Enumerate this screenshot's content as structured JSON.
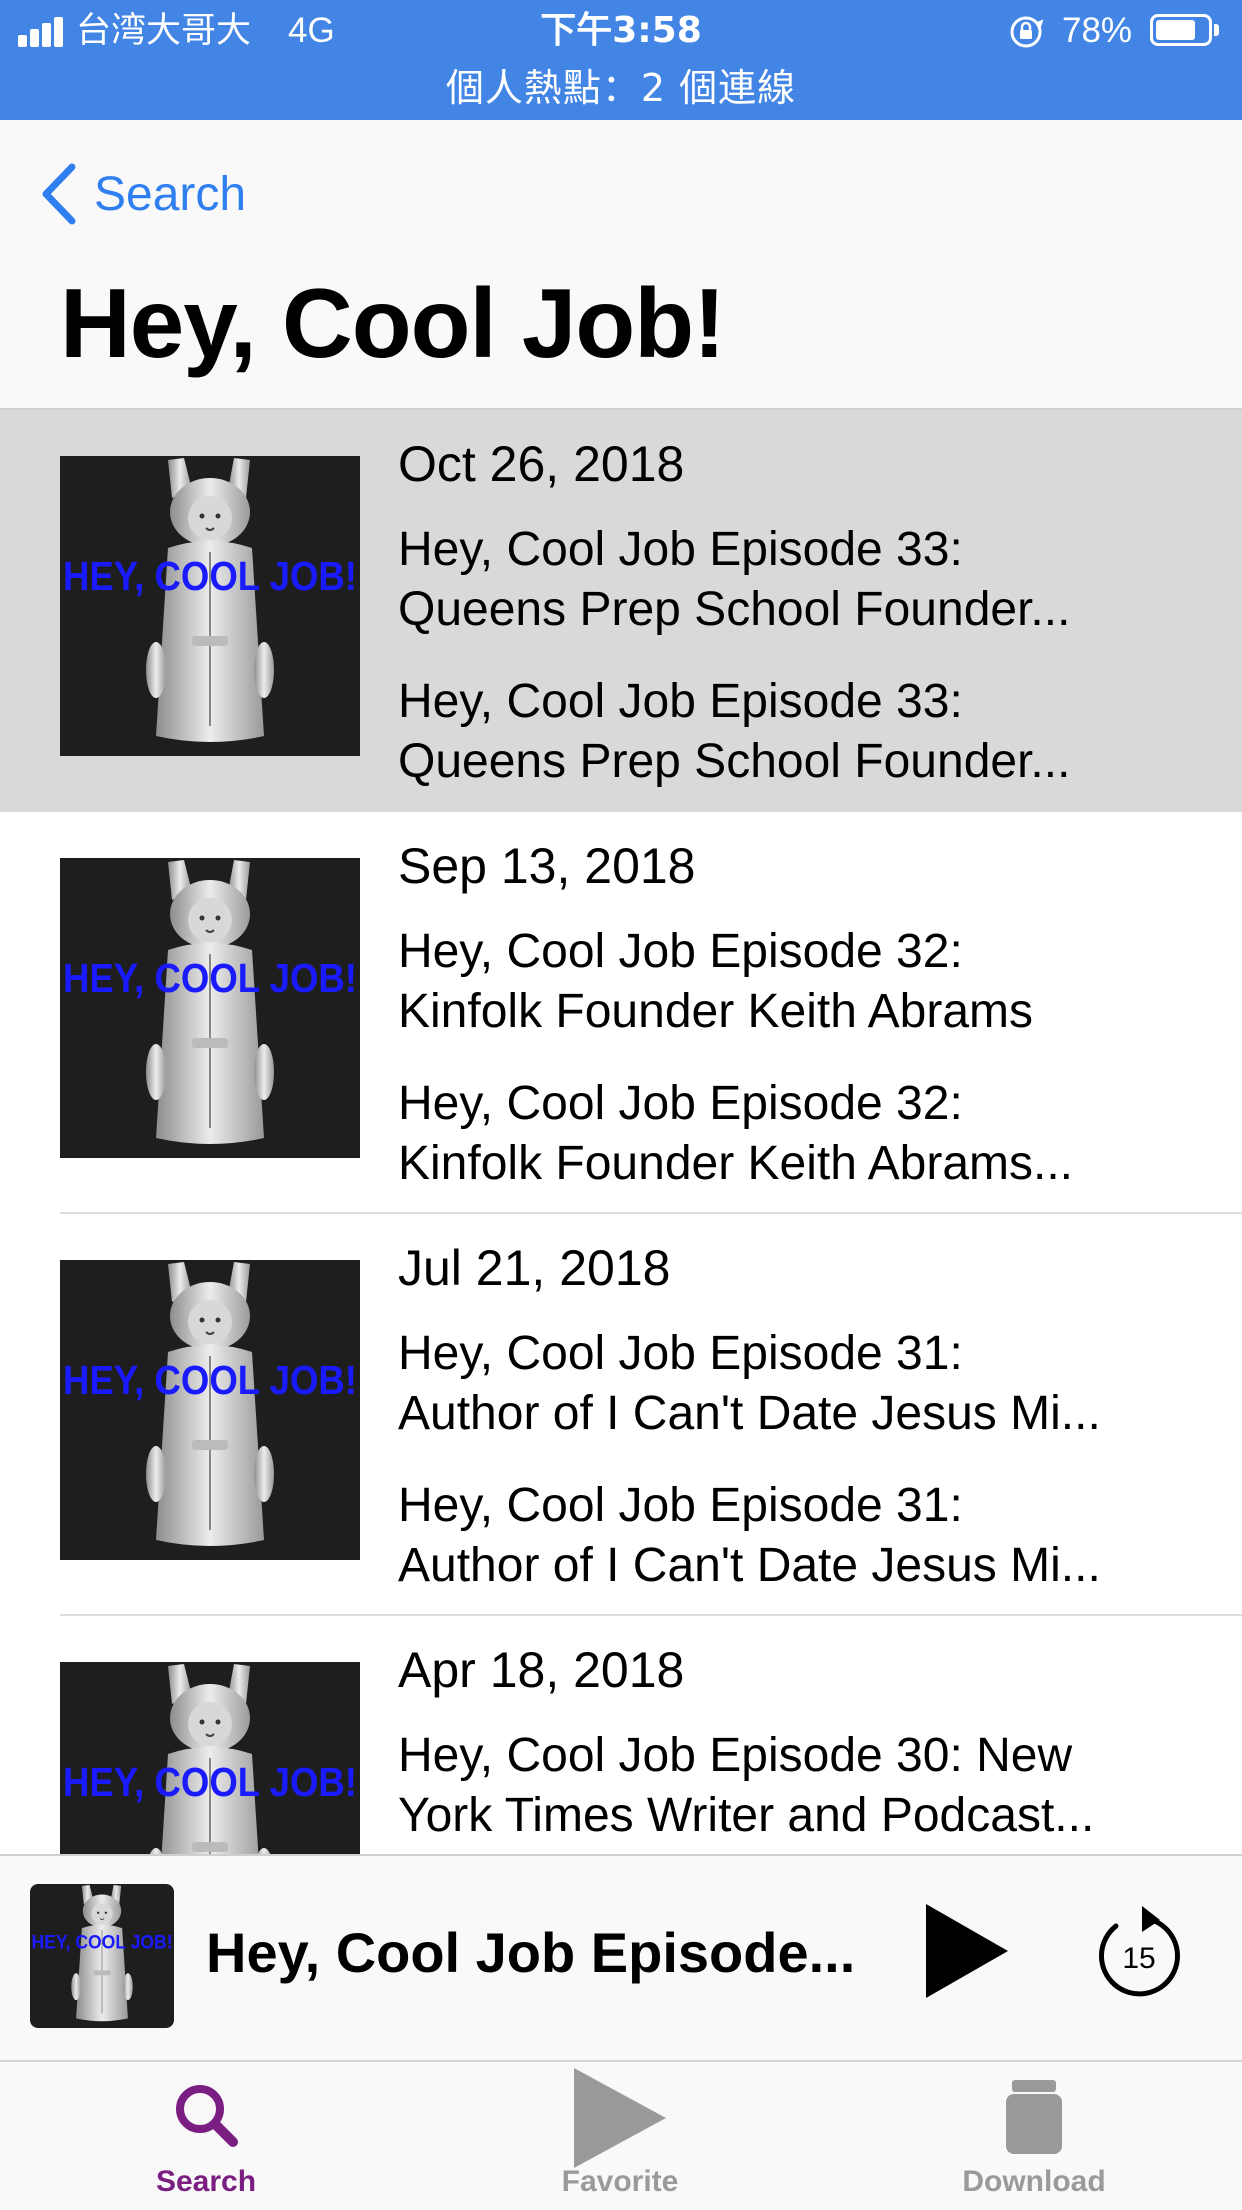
{
  "status_bar": {
    "carrier": "台湾大哥大",
    "network": "4G",
    "time": "下午3:58",
    "battery_percent": "78%",
    "battery_level": 0.78,
    "hotspot": "個人熱點：2 個連線",
    "background_color": "#4285e4"
  },
  "nav": {
    "back_label": "Search",
    "title": "Hey, Cool Job!",
    "accent_color": "#2f7ff0"
  },
  "artwork": {
    "text": "HEY, COOL JOB!",
    "text_color": "#1a1aff",
    "background_color": "#1e1e1e"
  },
  "episodes": [
    {
      "date": "Oct 26, 2018",
      "title_line1": "Hey, Cool Job Episode 33:",
      "title_line2": "Queens Prep School Founder...",
      "desc_line1": "Hey, Cool Job Episode 33:",
      "desc_line2": "Queens Prep School Founder...",
      "selected": true
    },
    {
      "date": "Sep 13, 2018",
      "title_line1": "Hey, Cool Job Episode 32:",
      "title_line2": "Kinfolk Founder Keith Abrams",
      "desc_line1": "Hey, Cool Job Episode 32:",
      "desc_line2": "Kinfolk Founder Keith Abrams...",
      "selected": false
    },
    {
      "date": "Jul 21, 2018",
      "title_line1": "Hey, Cool Job Episode 31:",
      "title_line2": "Author of I Can't Date Jesus Mi...",
      "desc_line1": "Hey, Cool Job Episode 31:",
      "desc_line2": "Author of I Can't Date Jesus Mi...",
      "selected": false
    },
    {
      "date": "Apr 18, 2018",
      "title_line1": "Hey, Cool Job Episode 30: New",
      "title_line2": "York Times Writer and Podcast...",
      "desc_line1": "",
      "desc_line2": "",
      "selected": false
    }
  ],
  "mini_player": {
    "title": "Hey, Cool Job Episode...",
    "play_icon": "play-icon",
    "skip_icon": "skip-forward-15-icon",
    "skip_seconds": "15"
  },
  "tab_bar": {
    "tabs": [
      {
        "label": "Search",
        "icon": "search-icon",
        "active": true
      },
      {
        "label": "Favorite",
        "icon": "play-triangle-icon",
        "active": false
      },
      {
        "label": "Download",
        "icon": "jar-icon",
        "active": false
      }
    ],
    "active_color": "#7b1e82",
    "inactive_color": "#9a9a9a"
  }
}
